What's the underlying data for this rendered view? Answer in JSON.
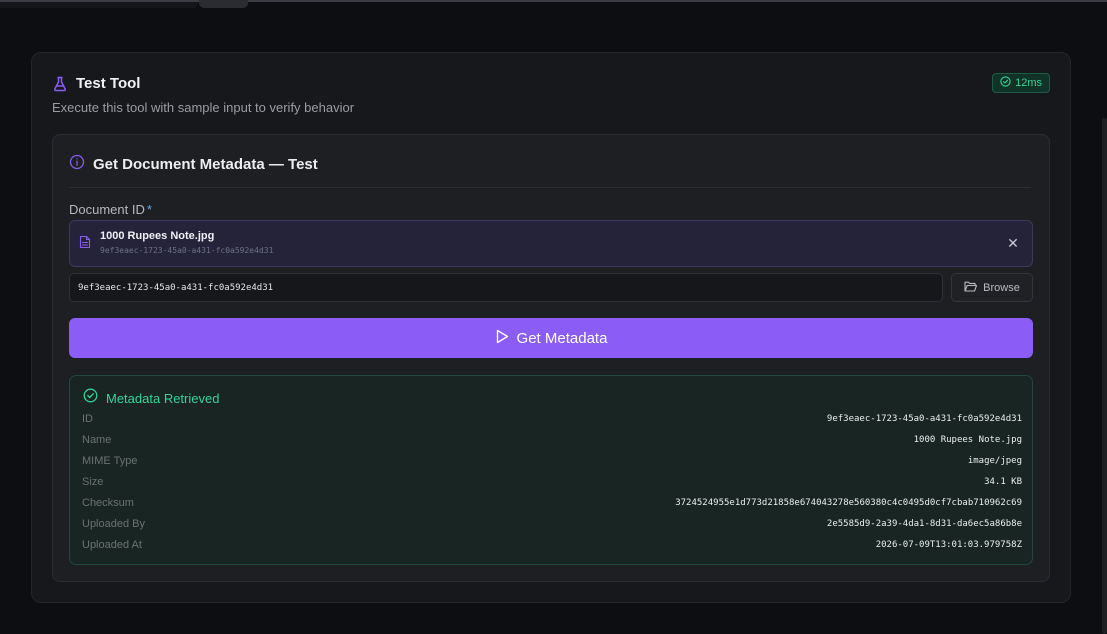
{
  "panel": {
    "title": "Test Tool",
    "subtitle": "Execute this tool with sample input to verify behavior",
    "timing": "12ms"
  },
  "test": {
    "title": "Get Document Metadata — Test",
    "field_label": "Document ID",
    "required_mark": "*",
    "selected_file": {
      "name": "1000 Rupees Note.jpg",
      "id": "9ef3eaec-1723-45a0-a431-fc0a592e4d31"
    },
    "input_value": "9ef3eaec-1723-45a0-a431-fc0a592e4d31",
    "browse_label": "Browse",
    "run_label": "Get Metadata"
  },
  "result": {
    "title": "Metadata Retrieved",
    "rows": [
      {
        "key": "ID",
        "value": "9ef3eaec-1723-45a0-a431-fc0a592e4d31"
      },
      {
        "key": "Name",
        "value": "1000 Rupees Note.jpg"
      },
      {
        "key": "MIME Type",
        "value": "image/jpeg"
      },
      {
        "key": "Size",
        "value": "34.1 KB"
      },
      {
        "key": "Checksum",
        "value": "3724524955e1d773d21858e674043278e560380c4c0495d0cf7cbab710962c69"
      },
      {
        "key": "Uploaded By",
        "value": "2e5585d9-2a39-4da1-8d31-da6ec5a86b8e"
      },
      {
        "key": "Uploaded At",
        "value": "2026-07-09T13:01:03.979758Z"
      }
    ]
  },
  "colors": {
    "accent": "#8b5cf6",
    "success": "#34d399"
  }
}
